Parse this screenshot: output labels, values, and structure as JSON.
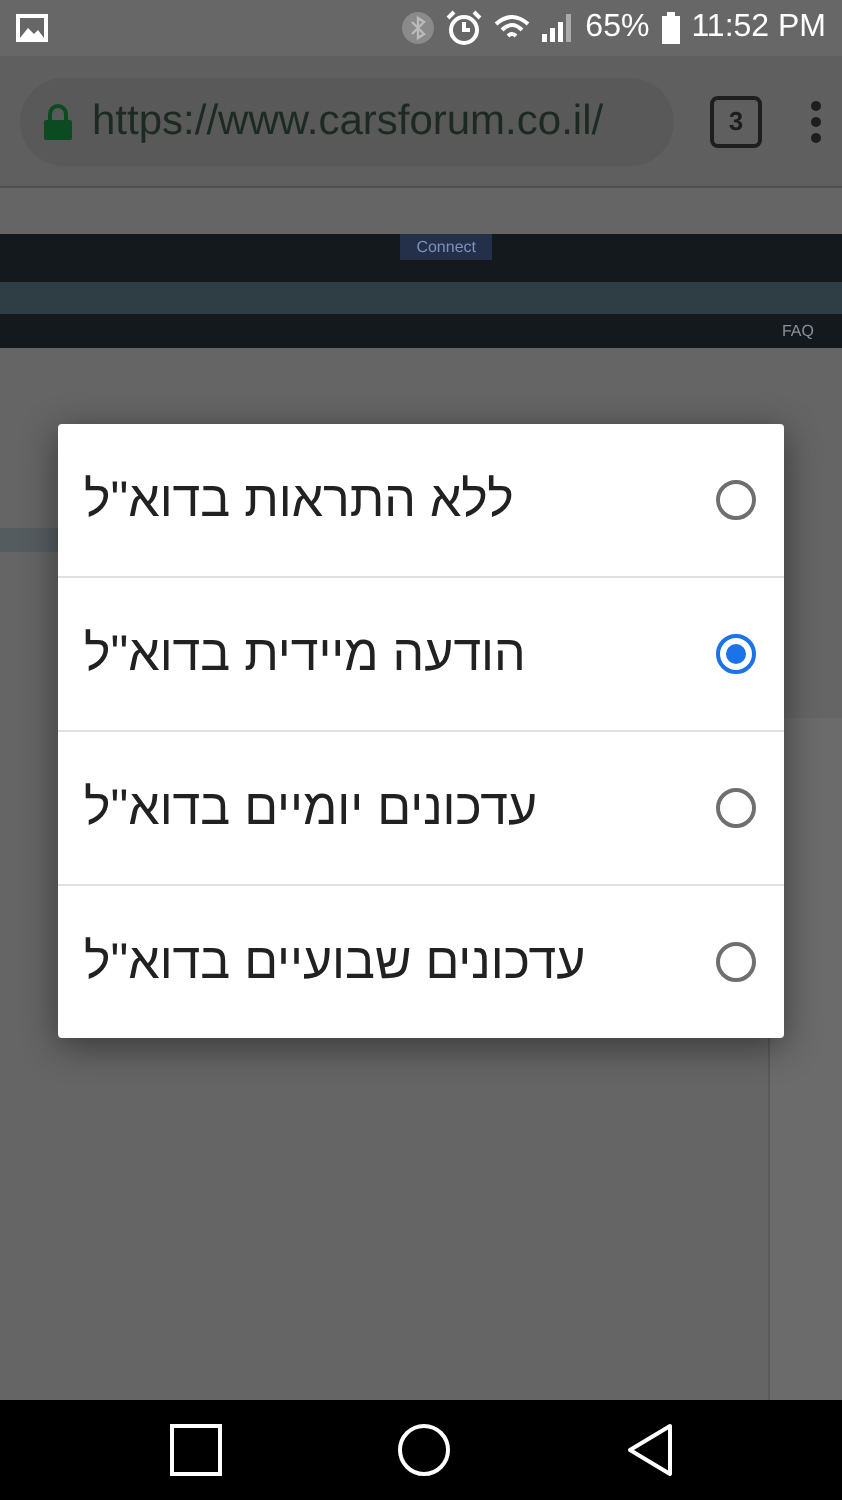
{
  "status_bar": {
    "battery": "65%",
    "time": "11:52 PM"
  },
  "browser": {
    "url": "https://www.carsforum.co.il/",
    "tab_count": "3"
  },
  "webpage": {
    "connect_button": "Connect",
    "nav_items": [
      "FAQ"
    ]
  },
  "dialog": {
    "options": [
      {
        "label": "ללא התראות בדוא\"ל",
        "selected": false
      },
      {
        "label": "הודעה מיידית בדוא\"ל",
        "selected": true
      },
      {
        "label": "עדכונים יומיים בדוא\"ל",
        "selected": false
      },
      {
        "label": "עדכונים שבועיים בדוא\"ל",
        "selected": false
      }
    ]
  }
}
